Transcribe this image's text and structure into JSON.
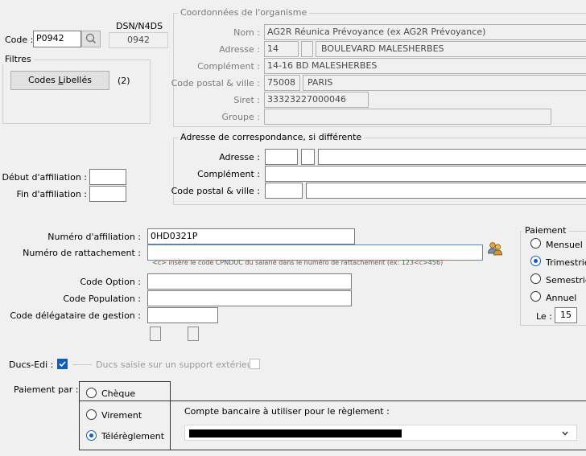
{
  "header": {
    "code_label": "Code :",
    "code_value": "P0942",
    "dsn_label": "DSN/N4DS",
    "dsn_value": "0942",
    "filters_label": "Filtres",
    "codes_button_pre": "Codes ",
    "codes_button_underline": "L",
    "codes_button_post": "ibellés",
    "codes_count": "(2)"
  },
  "organisme": {
    "title": "Coordonnées de l'organisme",
    "nom_label": "Nom :",
    "nom_value": "AG2R Réunica Prévoyance (ex AG2R Prévoyance)",
    "adresse_label": "Adresse :",
    "adresse_num": "14",
    "adresse_bis": "",
    "adresse_voie": "BOULEVARD MALESHERBES",
    "complement_label": "Complément :",
    "complement_value": "14-16 BD MALESHERBES",
    "cp_label": "Code postal & ville :",
    "cp_value": "75008",
    "ville_value": "PARIS",
    "siret_label": "Siret :",
    "siret_value": "33323227000046",
    "groupe_label": "Groupe :",
    "groupe_value": ""
  },
  "correspondance": {
    "title": "Adresse de correspondance, si différente",
    "adresse_label": "Adresse :",
    "complement_label": "Complément :",
    "cp_label": "Code postal & ville :"
  },
  "affiliation": {
    "debut_label": "Début d'affiliation :",
    "fin_label": "Fin d'affiliation :",
    "debut_value": "",
    "fin_value": ""
  },
  "details": {
    "numero_affiliation_label": "Numéro d'affiliation :",
    "numero_affiliation_value": "0HD0321P",
    "numero_rattachement_label": "Numéro de rattachement :",
    "numero_rattachement_value": "",
    "hint": "<c> insère le code CPNDUC du salarié dans le numéro de rattachement (ex: 123<c>456)",
    "code_option_label": "Code Option :",
    "code_population_label": "Code Population :",
    "code_delegataire_label": "Code délégataire de gestion :"
  },
  "paiement_freq": {
    "title": "Paiement",
    "options": [
      "Mensuel",
      "Trimestriel",
      "Semestriel",
      "Annuel"
    ],
    "selected": "Trimestriel",
    "le_label": "Le :",
    "le_value": "15"
  },
  "ducs": {
    "ducs_edi_label": "Ducs-Edi :",
    "ducs_edi_checked": true,
    "ducs_support_label": "Ducs saisie sur un support extérieur",
    "ducs_support_checked": false
  },
  "paiement_par": {
    "label": "Paiement par :",
    "options": [
      "Chèque",
      "Virement",
      "Télérèglement"
    ],
    "selected": "Télérèglement",
    "compte_label": "Compte bancaire à utiliser pour le règlement :"
  }
}
